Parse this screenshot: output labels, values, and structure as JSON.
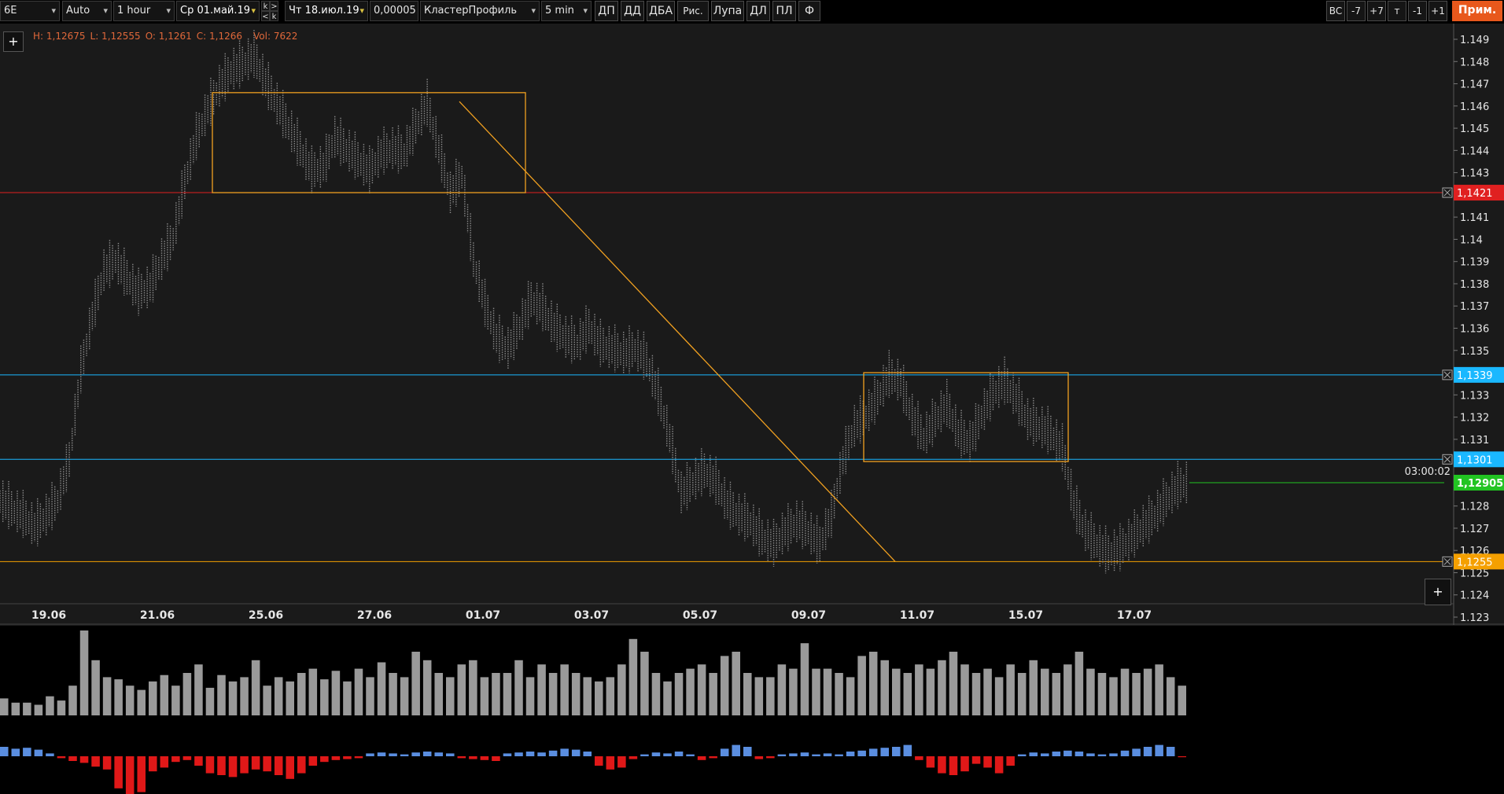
{
  "toolbar": {
    "symbol": "6E",
    "scale_mode": "Auto",
    "timeframe": "1 hour",
    "date_from": "Ср 01.май.19",
    "date_to": "Чт 18.июл.19",
    "tick_size": "0,00005",
    "chart_type": "КластерПрофиль",
    "cluster_interval": "5 min",
    "k_nav": [
      "k",
      ">",
      "<",
      "k"
    ],
    "tools": [
      "ДП",
      "ДД",
      "ДБА",
      "Рис.",
      "Лупа",
      "ДЛ",
      "ПЛ",
      "Ф"
    ],
    "right_buttons": [
      "ВС",
      "-7",
      "+7",
      "т",
      "-1",
      "+1"
    ],
    "apply_button": "Прим.",
    "apply_color": "#e8581c"
  },
  "plus_label": "+",
  "ohlc": {
    "high": "H: 1,12675",
    "low": "L: 1,12555",
    "open": "O: 1,1261",
    "close": "C: 1,1266",
    "volume": "Vol: 7622"
  },
  "chart_data": {
    "type": "line",
    "y_ticks": [
      "1.149",
      "1.148",
      "1.147",
      "1.146",
      "1.145",
      "1.144",
      "1.143",
      "1.142",
      "1.141",
      "1.14",
      "1.139",
      "1.138",
      "1.137",
      "1.136",
      "1.135",
      "1.134",
      "1.133",
      "1.132",
      "1.131",
      "1.13",
      "1.129",
      "1.128",
      "1.127",
      "1.126",
      "1.125",
      "1.124",
      "1.123"
    ],
    "ylim": [
      1.123,
      1.149
    ],
    "x_ticks": [
      "19.06",
      "21.06",
      "25.06",
      "27.06",
      "01.07",
      "03.07",
      "05.07",
      "09.07",
      "11.07",
      "15.07",
      "17.07"
    ],
    "price_path": [
      1.1282,
      1.1278,
      1.1275,
      1.127,
      1.1275,
      1.1282,
      1.13,
      1.134,
      1.1365,
      1.1385,
      1.139,
      1.1382,
      1.1375,
      1.1378,
      1.139,
      1.14,
      1.1425,
      1.1445,
      1.1458,
      1.1468,
      1.1475,
      1.1478,
      1.1482,
      1.147,
      1.146,
      1.145,
      1.144,
      1.143,
      1.1432,
      1.1445,
      1.144,
      1.1435,
      1.143,
      1.1438,
      1.144,
      1.1438,
      1.145,
      1.146,
      1.144,
      1.142,
      1.1428,
      1.139,
      1.137,
      1.1355,
      1.135,
      1.136,
      1.1372,
      1.1368,
      1.136,
      1.1355,
      1.1352,
      1.136,
      1.1352,
      1.135,
      1.1348,
      1.135,
      1.1345,
      1.133,
      1.131,
      1.1285,
      1.129,
      1.1295,
      1.129,
      1.128,
      1.1275,
      1.1272,
      1.1265,
      1.1262,
      1.1268,
      1.1272,
      1.1268,
      1.1262,
      1.1275,
      1.13,
      1.1315,
      1.132,
      1.1328,
      1.1338,
      1.1335,
      1.132,
      1.131,
      1.1318,
      1.1325,
      1.1312,
      1.1308,
      1.132,
      1.133,
      1.1335,
      1.1328,
      1.1318,
      1.1315,
      1.1312,
      1.1305,
      1.128,
      1.1268,
      1.1262,
      1.1258,
      1.126,
      1.1265,
      1.127,
      1.1275,
      1.1282,
      1.1288,
      1.129
    ],
    "levels": [
      {
        "value": 1.1421,
        "label": "1,1421",
        "color": "#e02020"
      },
      {
        "value": 1.1339,
        "label": "1,1339",
        "color": "#1ab8ff"
      },
      {
        "value": 1.1301,
        "label": "1,1301",
        "color": "#1ab8ff"
      },
      {
        "value": 1.1255,
        "label": "1,1255",
        "color": "#f5a000"
      }
    ],
    "current_price": {
      "value": 1.12905,
      "label": "1,12905",
      "color": "#22c422"
    },
    "timer": "03:00:02",
    "rectangles": [
      {
        "x_from": "21.06",
        "x_to": "01.07",
        "y_top": 1.1466,
        "y_bottom": 1.1421
      },
      {
        "x_from": "09.07",
        "x_to": "15.07",
        "y_top": 1.134,
        "y_bottom": 1.13
      }
    ],
    "trend_line": {
      "from": 1.1462,
      "to": 1.1255
    },
    "volume": [
      8,
      6,
      6,
      5,
      9,
      7,
      14,
      40,
      26,
      18,
      17,
      14,
      12,
      16,
      19,
      14,
      20,
      24,
      13,
      19,
      16,
      18,
      26,
      14,
      18,
      16,
      20,
      22,
      17,
      21,
      16,
      22,
      18,
      25,
      20,
      18,
      30,
      26,
      20,
      18,
      24,
      26,
      18,
      20,
      20,
      26,
      18,
      24,
      20,
      24,
      20,
      18,
      16,
      18,
      24,
      36,
      30,
      20,
      16,
      20,
      22,
      24,
      20,
      28,
      30,
      20,
      18,
      18,
      24,
      22,
      34,
      22,
      22,
      20,
      18,
      28,
      30,
      26,
      22,
      20,
      24,
      22,
      26,
      30,
      24,
      20,
      22,
      18,
      24,
      20,
      26,
      22,
      20,
      24,
      30,
      22,
      20,
      18,
      22,
      20,
      22,
      24,
      18,
      14
    ],
    "delta": [
      10,
      8,
      9,
      7,
      3,
      -2,
      -5,
      -7,
      -11,
      -14,
      -34,
      -40,
      -38,
      -16,
      -12,
      -6,
      -4,
      -10,
      -18,
      -20,
      -22,
      -18,
      -14,
      -16,
      -20,
      -24,
      -18,
      -10,
      -6,
      -4,
      -3,
      -2,
      3,
      4,
      3,
      2,
      4,
      5,
      4,
      3,
      -2,
      -3,
      -4,
      -5,
      3,
      4,
      5,
      4,
      6,
      8,
      7,
      5,
      -10,
      -14,
      -12,
      -3,
      2,
      4,
      3,
      5,
      2,
      -4,
      -2,
      8,
      12,
      10,
      -3,
      -2,
      2,
      3,
      4,
      2,
      3,
      2,
      5,
      6,
      8,
      9,
      10,
      12,
      -4,
      -12,
      -18,
      -20,
      -16,
      -8,
      -12,
      -18,
      -10,
      2,
      4,
      3,
      5,
      6,
      5,
      3,
      2,
      3,
      6,
      8,
      10,
      12,
      10,
      -1
    ]
  }
}
